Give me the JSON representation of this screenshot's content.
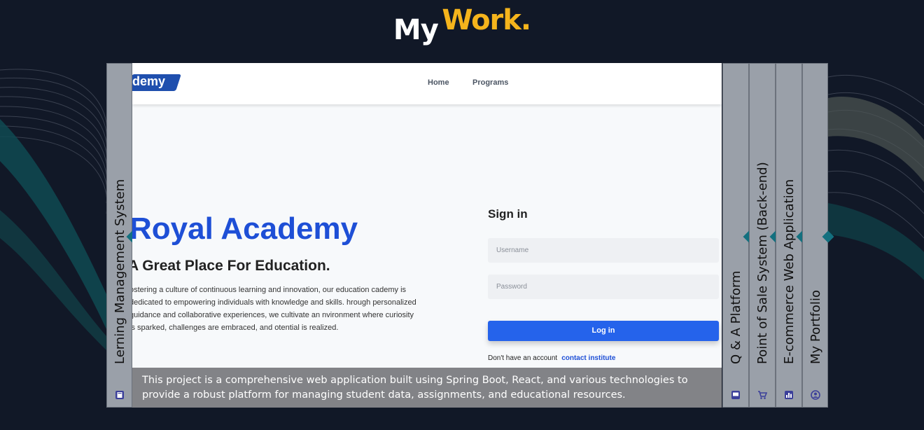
{
  "section_title": {
    "word1": "My",
    "word2": "Work."
  },
  "colors": {
    "accent": "#f5b41c",
    "background": "#111827",
    "panel": "#9aa0a9",
    "diamond": "#13707f",
    "brand_blue": "#1e4fd6",
    "button_blue": "#2563eb"
  },
  "projects": {
    "active": {
      "label": "Lerning Management System",
      "icon": "book-icon"
    },
    "others": [
      {
        "label": "Q & A Platform",
        "icon": "chat-icon"
      },
      {
        "label": "Point of Sale System (Back-end)",
        "icon": "cart-icon"
      },
      {
        "label": "E-commerce Web Application",
        "icon": "chart-icon"
      },
      {
        "label": "My Portfolio",
        "icon": "user-circle-icon"
      }
    ]
  },
  "preview": {
    "logo_text": "demy",
    "nav": {
      "home": "Home",
      "programs": "Programs"
    },
    "hero_title": "Royal Academy",
    "hero_subtitle": "A Great Place For Education.",
    "hero_paragraph": "ostering a culture of continuous learning and innovation, our education cademy is dedicated to empowering individuals with knowledge and skills. hrough personalized guidance and collaborative experiences, we cultivate an nvironment where curiosity is sparked, challenges are embraced, and otential is realized.",
    "signin_title": "Sign in",
    "username_placeholder": "Username",
    "password_placeholder": "Password",
    "login_button": "Log in",
    "no_account_text": "Don't have an account",
    "contact_link": "contact institute"
  },
  "caption": "This project is a comprehensive web application built using Spring Boot, React, and various technologies to provide a robust platform for managing student data, assignments, and educational resources."
}
